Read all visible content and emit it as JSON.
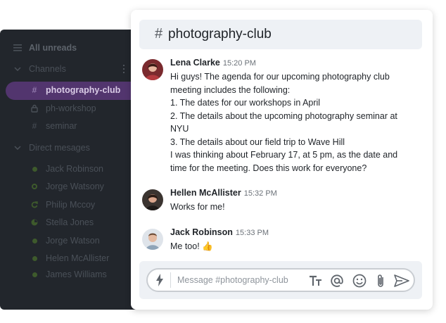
{
  "sidebar": {
    "all_unreads": "All unreads",
    "channels_label": "Channels",
    "channels": [
      {
        "name": "photography-club",
        "icon": "hash-icon",
        "active": true
      },
      {
        "name": "ph-workshop",
        "icon": "lock-icon",
        "active": false
      },
      {
        "name": "seminar",
        "icon": "hash-icon",
        "active": false
      }
    ],
    "dm_label": "Direct mesages",
    "direct_messages": [
      {
        "name": "Jack Robinson",
        "status": "online"
      },
      {
        "name": "Jorge Watsony",
        "status": "away"
      },
      {
        "name": "Philip Mccoy",
        "status": "sync"
      },
      {
        "name": "Stella Jones",
        "status": "busy"
      },
      {
        "name": "Jorge Watson",
        "status": "online"
      },
      {
        "name": "Helen McAllister",
        "status": "online"
      },
      {
        "name": "James Williams",
        "status": "online"
      }
    ]
  },
  "channel": {
    "hash": "#",
    "name": "photography-club"
  },
  "messages": [
    {
      "author": "Lena Clarke",
      "time": "15:20 PM",
      "lines": [
        "Hi guys! The agenda for our upcoming photography club",
        "meeting includes the following:",
        "1. The dates for our workshops in April",
        "2. The details about the upcoming photography seminar at",
        "NYU",
        "3. The details about our field trip to Wave Hill",
        "I was thinking about February 17, at 5 pm, as the date and",
        "time for the meeting. Does this work for everyone?"
      ]
    },
    {
      "author": "Hellen McAllister",
      "time": "15:32 PM",
      "lines": [
        "Works for me!"
      ]
    },
    {
      "author": "Jack Robinson",
      "time": "15:33 PM",
      "lines": [
        "Me too! 👍"
      ]
    }
  ],
  "composer": {
    "placeholder": "Message #photography-club",
    "tools": [
      "bolt-icon",
      "text-format-icon",
      "mention-icon",
      "emoji-icon",
      "attachment-icon",
      "send-icon"
    ]
  },
  "colors": {
    "sidebar_bg": "#22262c",
    "active_channel": "#52356e",
    "header_bg": "#eef1f5"
  }
}
